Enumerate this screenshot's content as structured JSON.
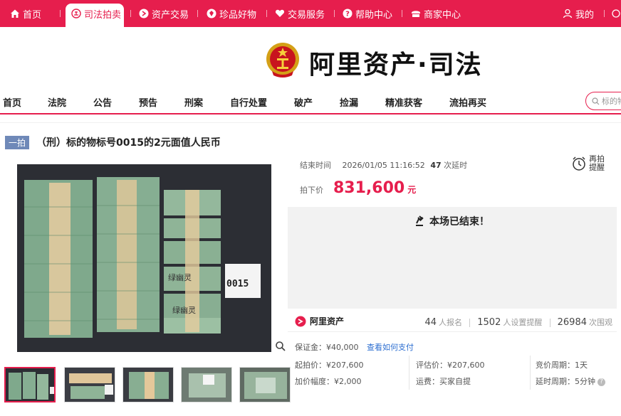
{
  "topnav": {
    "items": [
      {
        "label": "首页",
        "icon": "home-icon"
      },
      {
        "label": "司法拍卖",
        "icon": "court-icon",
        "active": true
      },
      {
        "label": "资产交易",
        "icon": "asset-icon"
      },
      {
        "label": "珍品好物",
        "icon": "gem-icon"
      },
      {
        "label": "交易服务",
        "icon": "heart-icon"
      },
      {
        "label": "帮助中心",
        "icon": "help-icon"
      },
      {
        "label": "商家中心",
        "icon": "merchant-icon"
      }
    ],
    "user_label": "我的",
    "brand_color": "#e61e4d"
  },
  "logo": {
    "text": "阿里资产·司法"
  },
  "subnav": {
    "items": [
      "首页",
      "法院",
      "公告",
      "预告",
      "刑案",
      "自行处置",
      "破产",
      "捡漏",
      "精准获客",
      "流拍再买"
    ],
    "search_placeholder": "标的物"
  },
  "listing": {
    "badge": "一拍",
    "title": "（刑）标的物标号0015的2元面值人民币",
    "photo_card_number": "0015",
    "photo_note_1": "绿幽灵",
    "photo_note_2": "绿幽灵",
    "end_label": "结束时间",
    "end_time": "2026/01/05 11:16:52",
    "delay_count": "47",
    "delay_suffix": "次延时",
    "remind_line1": "再拍",
    "remind_line2": "提醒",
    "price_label": "拍下价",
    "price": "831,600",
    "price_unit": "元",
    "ended_text": "本场已结束！",
    "brand": "阿里资产",
    "signups": "44",
    "signups_label": "人报名",
    "reminders": "1502",
    "reminders_label": "人设置提醒",
    "views": "26984",
    "views_label": "次围观",
    "deposit": "保证金：¥40,000",
    "deposit_link": "查看如何支付",
    "start_price": "起拍价：¥207,600",
    "increment": "加价幅度：¥2,000",
    "appraisal": "评估价：¥207,600",
    "shipping": "运费：买家自提",
    "bid_cycle": "竞价周期：1天",
    "delay_cycle": "延时周期：5分钟"
  }
}
